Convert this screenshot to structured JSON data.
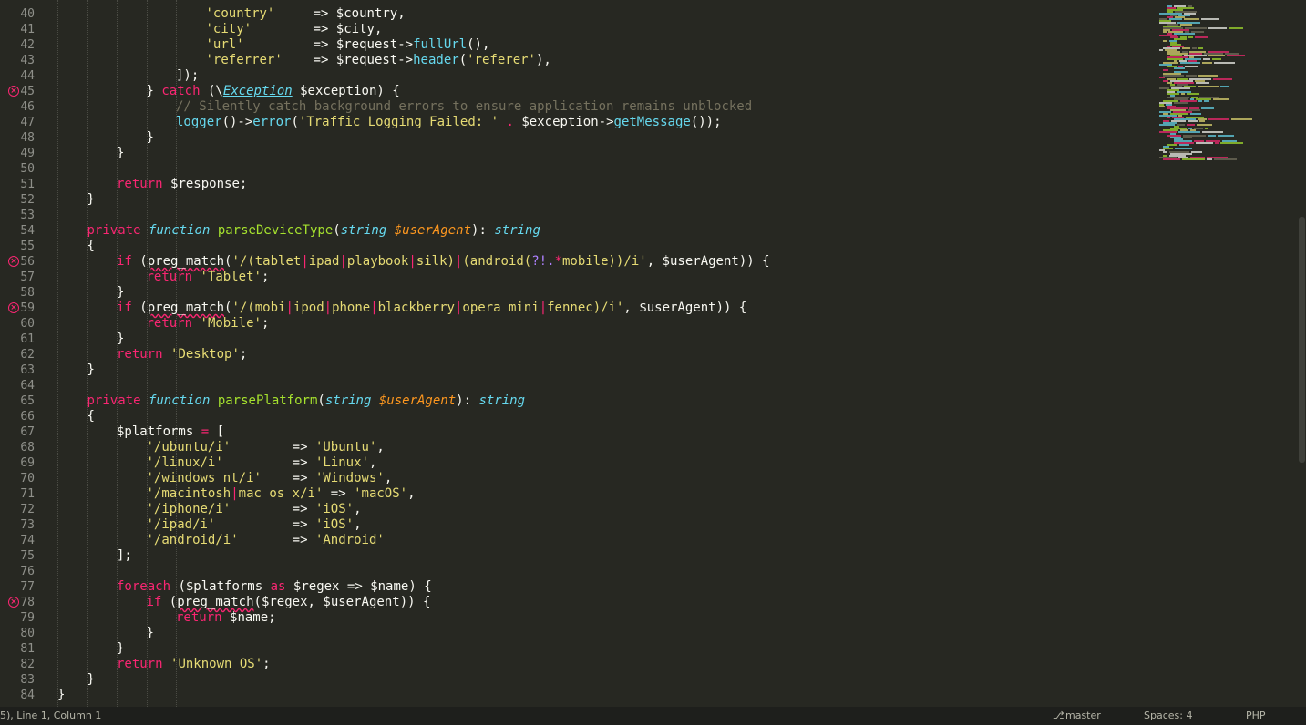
{
  "colors": {
    "background": "#272822",
    "keyword": "#f92672",
    "storage": "#66d9ef",
    "function": "#a6e22e",
    "string": "#e6db74",
    "parameter": "#fd971f",
    "comment": "#75715e",
    "error_marker": "#f92672",
    "status_bar": "#1e1f1c"
  },
  "gutter": {
    "error_icon": "error-circle-icon",
    "lines": [
      {
        "num": "40",
        "err": false
      },
      {
        "num": "41",
        "err": false
      },
      {
        "num": "42",
        "err": false
      },
      {
        "num": "43",
        "err": false
      },
      {
        "num": "44",
        "err": false
      },
      {
        "num": "45",
        "err": true
      },
      {
        "num": "46",
        "err": false
      },
      {
        "num": "47",
        "err": false
      },
      {
        "num": "48",
        "err": false
      },
      {
        "num": "49",
        "err": false
      },
      {
        "num": "50",
        "err": false
      },
      {
        "num": "51",
        "err": false
      },
      {
        "num": "52",
        "err": false
      },
      {
        "num": "53",
        "err": false
      },
      {
        "num": "54",
        "err": false
      },
      {
        "num": "55",
        "err": false
      },
      {
        "num": "56",
        "err": true
      },
      {
        "num": "57",
        "err": false
      },
      {
        "num": "58",
        "err": false
      },
      {
        "num": "59",
        "err": true
      },
      {
        "num": "60",
        "err": false
      },
      {
        "num": "61",
        "err": false
      },
      {
        "num": "62",
        "err": false
      },
      {
        "num": "63",
        "err": false
      },
      {
        "num": "64",
        "err": false
      },
      {
        "num": "65",
        "err": false
      },
      {
        "num": "66",
        "err": false
      },
      {
        "num": "67",
        "err": false
      },
      {
        "num": "68",
        "err": false
      },
      {
        "num": "69",
        "err": false
      },
      {
        "num": "70",
        "err": false
      },
      {
        "num": "71",
        "err": false
      },
      {
        "num": "72",
        "err": false
      },
      {
        "num": "73",
        "err": false
      },
      {
        "num": "74",
        "err": false
      },
      {
        "num": "75",
        "err": false
      },
      {
        "num": "76",
        "err": false
      },
      {
        "num": "77",
        "err": false
      },
      {
        "num": "78",
        "err": true
      },
      {
        "num": "79",
        "err": false
      },
      {
        "num": "80",
        "err": false
      },
      {
        "num": "81",
        "err": false
      },
      {
        "num": "82",
        "err": false
      },
      {
        "num": "83",
        "err": false
      },
      {
        "num": "84",
        "err": false
      }
    ]
  },
  "code_lines": [
    {
      "indent": 5,
      "tokens": [
        [
          "str",
          "'country'"
        ],
        [
          "plain",
          "     => "
        ],
        [
          "var",
          "$country"
        ],
        [
          "plain",
          ","
        ]
      ]
    },
    {
      "indent": 5,
      "tokens": [
        [
          "str",
          "'city'"
        ],
        [
          "plain",
          "        => "
        ],
        [
          "var",
          "$city"
        ],
        [
          "plain",
          ","
        ]
      ]
    },
    {
      "indent": 5,
      "tokens": [
        [
          "str",
          "'url'"
        ],
        [
          "plain",
          "         => "
        ],
        [
          "var",
          "$request"
        ],
        [
          "plain",
          "->"
        ],
        [
          "call",
          "fullUrl"
        ],
        [
          "plain",
          "(),"
        ]
      ]
    },
    {
      "indent": 5,
      "tokens": [
        [
          "str",
          "'referrer'"
        ],
        [
          "plain",
          "    => "
        ],
        [
          "var",
          "$request"
        ],
        [
          "plain",
          "->"
        ],
        [
          "call",
          "header"
        ],
        [
          "plain",
          "("
        ],
        [
          "str",
          "'referer'"
        ],
        [
          "plain",
          "),"
        ]
      ]
    },
    {
      "indent": 4,
      "tokens": [
        [
          "plain",
          "]);"
        ]
      ]
    },
    {
      "indent": 3,
      "tokens": [
        [
          "plain",
          "} "
        ],
        [
          "kw",
          "catch"
        ],
        [
          "plain",
          " (\\"
        ],
        [
          "cls",
          "Exception"
        ],
        [
          "plain",
          " "
        ],
        [
          "var",
          "$exception"
        ],
        [
          "plain",
          ") {"
        ]
      ]
    },
    {
      "indent": 4,
      "tokens": [
        [
          "cmt",
          "// Silently catch background errors to ensure application remains unblocked"
        ]
      ]
    },
    {
      "indent": 4,
      "tokens": [
        [
          "call",
          "logger"
        ],
        [
          "plain",
          "()->"
        ],
        [
          "call",
          "error"
        ],
        [
          "plain",
          "("
        ],
        [
          "str",
          "'Traffic Logging Failed: '"
        ],
        [
          "plain",
          " "
        ],
        [
          "op",
          "."
        ],
        [
          "plain",
          " "
        ],
        [
          "var",
          "$exception"
        ],
        [
          "plain",
          "->"
        ],
        [
          "call",
          "getMessage"
        ],
        [
          "plain",
          "());"
        ]
      ]
    },
    {
      "indent": 3,
      "tokens": [
        [
          "plain",
          "}"
        ]
      ]
    },
    {
      "indent": 2,
      "tokens": [
        [
          "plain",
          "}"
        ]
      ]
    },
    {
      "indent": 0,
      "tokens": []
    },
    {
      "indent": 2,
      "tokens": [
        [
          "kw",
          "return"
        ],
        [
          "plain",
          " "
        ],
        [
          "var",
          "$response"
        ],
        [
          "plain",
          ";"
        ]
      ]
    },
    {
      "indent": 1,
      "tokens": [
        [
          "plain",
          "}"
        ]
      ]
    },
    {
      "indent": 0,
      "tokens": []
    },
    {
      "indent": 1,
      "tokens": [
        [
          "kw",
          "private"
        ],
        [
          "plain",
          " "
        ],
        [
          "storage",
          "function"
        ],
        [
          "plain",
          " "
        ],
        [
          "fn",
          "parseDeviceType"
        ],
        [
          "plain",
          "("
        ],
        [
          "storage",
          "string"
        ],
        [
          "plain",
          " "
        ],
        [
          "param",
          "$userAgent"
        ],
        [
          "plain",
          "): "
        ],
        [
          "storage",
          "string"
        ]
      ]
    },
    {
      "indent": 1,
      "tokens": [
        [
          "plain",
          "{"
        ]
      ]
    },
    {
      "indent": 2,
      "tokens": [
        [
          "kw",
          "if"
        ],
        [
          "plain",
          " ("
        ],
        [
          "squig",
          "preg_match"
        ],
        [
          "plain",
          "("
        ],
        [
          "str",
          "'/(tablet"
        ],
        [
          "op",
          "|"
        ],
        [
          "str",
          "ipad"
        ],
        [
          "op",
          "|"
        ],
        [
          "str",
          "playbook"
        ],
        [
          "op",
          "|"
        ],
        [
          "str",
          "silk)"
        ],
        [
          "op",
          "|"
        ],
        [
          "str",
          "(android("
        ],
        [
          "rx",
          "?!."
        ],
        [
          "op",
          "*"
        ],
        [
          "str",
          "mobile))/i'"
        ],
        [
          "plain",
          ", "
        ],
        [
          "var",
          "$userAgent"
        ],
        [
          "plain",
          ")) {"
        ]
      ]
    },
    {
      "indent": 3,
      "tokens": [
        [
          "kw",
          "return"
        ],
        [
          "plain",
          " "
        ],
        [
          "str",
          "'Tablet'"
        ],
        [
          "plain",
          ";"
        ]
      ]
    },
    {
      "indent": 2,
      "tokens": [
        [
          "plain",
          "}"
        ]
      ]
    },
    {
      "indent": 2,
      "tokens": [
        [
          "kw",
          "if"
        ],
        [
          "plain",
          " ("
        ],
        [
          "squig",
          "preg_match"
        ],
        [
          "plain",
          "("
        ],
        [
          "str",
          "'/(mobi"
        ],
        [
          "op",
          "|"
        ],
        [
          "str",
          "ipod"
        ],
        [
          "op",
          "|"
        ],
        [
          "str",
          "phone"
        ],
        [
          "op",
          "|"
        ],
        [
          "str",
          "blackberry"
        ],
        [
          "op",
          "|"
        ],
        [
          "str",
          "opera mini"
        ],
        [
          "op",
          "|"
        ],
        [
          "str",
          "fennec)/i'"
        ],
        [
          "plain",
          ", "
        ],
        [
          "var",
          "$userAgent"
        ],
        [
          "plain",
          ")) {"
        ]
      ]
    },
    {
      "indent": 3,
      "tokens": [
        [
          "kw",
          "return"
        ],
        [
          "plain",
          " "
        ],
        [
          "str",
          "'Mobile'"
        ],
        [
          "plain",
          ";"
        ]
      ]
    },
    {
      "indent": 2,
      "tokens": [
        [
          "plain",
          "}"
        ]
      ]
    },
    {
      "indent": 2,
      "tokens": [
        [
          "kw",
          "return"
        ],
        [
          "plain",
          " "
        ],
        [
          "str",
          "'Desktop'"
        ],
        [
          "plain",
          ";"
        ]
      ]
    },
    {
      "indent": 1,
      "tokens": [
        [
          "plain",
          "}"
        ]
      ]
    },
    {
      "indent": 0,
      "tokens": []
    },
    {
      "indent": 1,
      "tokens": [
        [
          "kw",
          "private"
        ],
        [
          "plain",
          " "
        ],
        [
          "storage",
          "function"
        ],
        [
          "plain",
          " "
        ],
        [
          "fn",
          "parsePlatform"
        ],
        [
          "plain",
          "("
        ],
        [
          "storage",
          "string"
        ],
        [
          "plain",
          " "
        ],
        [
          "param",
          "$userAgent"
        ],
        [
          "plain",
          "): "
        ],
        [
          "storage",
          "string"
        ]
      ]
    },
    {
      "indent": 1,
      "tokens": [
        [
          "plain",
          "{"
        ]
      ]
    },
    {
      "indent": 2,
      "tokens": [
        [
          "var",
          "$platforms"
        ],
        [
          "plain",
          " "
        ],
        [
          "op",
          "="
        ],
        [
          "plain",
          " ["
        ]
      ]
    },
    {
      "indent": 3,
      "tokens": [
        [
          "str",
          "'/ubuntu/i'"
        ],
        [
          "plain",
          "        => "
        ],
        [
          "str",
          "'Ubuntu'"
        ],
        [
          "plain",
          ","
        ]
      ]
    },
    {
      "indent": 3,
      "tokens": [
        [
          "str",
          "'/linux/i'"
        ],
        [
          "plain",
          "         => "
        ],
        [
          "str",
          "'Linux'"
        ],
        [
          "plain",
          ","
        ]
      ]
    },
    {
      "indent": 3,
      "tokens": [
        [
          "str",
          "'/windows nt/i'"
        ],
        [
          "plain",
          "    => "
        ],
        [
          "str",
          "'Windows'"
        ],
        [
          "plain",
          ","
        ]
      ]
    },
    {
      "indent": 3,
      "tokens": [
        [
          "str",
          "'/macintosh"
        ],
        [
          "op",
          "|"
        ],
        [
          "str",
          "mac os x/i'"
        ],
        [
          "plain",
          " => "
        ],
        [
          "str",
          "'macOS'"
        ],
        [
          "plain",
          ","
        ]
      ]
    },
    {
      "indent": 3,
      "tokens": [
        [
          "str",
          "'/iphone/i'"
        ],
        [
          "plain",
          "        => "
        ],
        [
          "str",
          "'iOS'"
        ],
        [
          "plain",
          ","
        ]
      ]
    },
    {
      "indent": 3,
      "tokens": [
        [
          "str",
          "'/ipad/i'"
        ],
        [
          "plain",
          "          => "
        ],
        [
          "str",
          "'iOS'"
        ],
        [
          "plain",
          ","
        ]
      ]
    },
    {
      "indent": 3,
      "tokens": [
        [
          "str",
          "'/android/i'"
        ],
        [
          "plain",
          "       => "
        ],
        [
          "str",
          "'Android'"
        ]
      ]
    },
    {
      "indent": 2,
      "tokens": [
        [
          "plain",
          "];"
        ]
      ]
    },
    {
      "indent": 0,
      "tokens": []
    },
    {
      "indent": 2,
      "tokens": [
        [
          "kw",
          "foreach"
        ],
        [
          "plain",
          " ("
        ],
        [
          "var",
          "$platforms"
        ],
        [
          "plain",
          " "
        ],
        [
          "kw",
          "as"
        ],
        [
          "plain",
          " "
        ],
        [
          "var",
          "$regex"
        ],
        [
          "plain",
          " => "
        ],
        [
          "var",
          "$name"
        ],
        [
          "plain",
          ") {"
        ]
      ]
    },
    {
      "indent": 3,
      "tokens": [
        [
          "kw",
          "if"
        ],
        [
          "plain",
          " ("
        ],
        [
          "squig",
          "preg_match"
        ],
        [
          "plain",
          "("
        ],
        [
          "var",
          "$regex"
        ],
        [
          "plain",
          ", "
        ],
        [
          "var",
          "$userAgent"
        ],
        [
          "plain",
          ")) {"
        ]
      ]
    },
    {
      "indent": 4,
      "tokens": [
        [
          "kw",
          "return"
        ],
        [
          "plain",
          " "
        ],
        [
          "var",
          "$name"
        ],
        [
          "plain",
          ";"
        ]
      ]
    },
    {
      "indent": 3,
      "tokens": [
        [
          "plain",
          "}"
        ]
      ]
    },
    {
      "indent": 2,
      "tokens": [
        [
          "plain",
          "}"
        ]
      ]
    },
    {
      "indent": 2,
      "tokens": [
        [
          "kw",
          "return"
        ],
        [
          "plain",
          " "
        ],
        [
          "str",
          "'Unknown OS'"
        ],
        [
          "plain",
          ";"
        ]
      ]
    },
    {
      "indent": 1,
      "tokens": [
        [
          "plain",
          "}"
        ]
      ]
    },
    {
      "indent": 0,
      "tokens": [
        [
          "plain",
          "}"
        ]
      ]
    }
  ],
  "status_bar": {
    "position": "5), Line 1, Column 1",
    "branch_icon": "git-branch-icon",
    "branch": "master",
    "indentation": "Spaces: 4",
    "syntax": "PHP"
  }
}
